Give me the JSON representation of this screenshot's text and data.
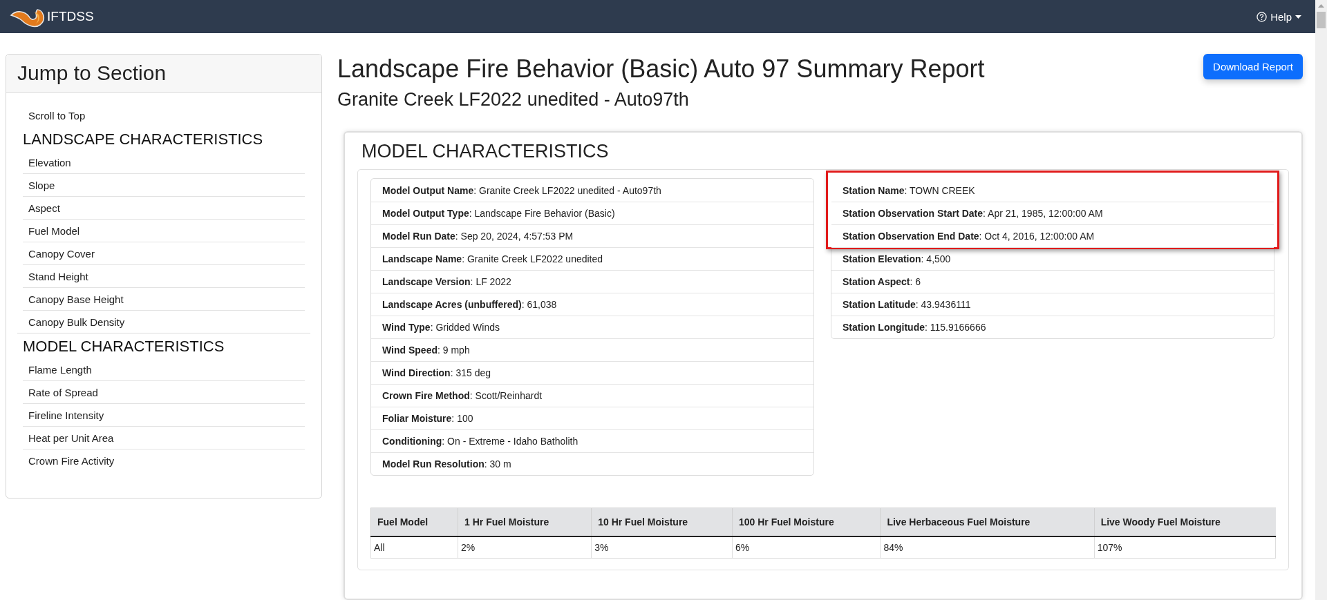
{
  "navbar": {
    "brand": "IFTDSS",
    "help": "Help"
  },
  "sidebar": {
    "title": "Jump to Section",
    "top_link": "Scroll to Top",
    "groups": [
      {
        "heading": "LANDSCAPE CHARACTERISTICS",
        "items": [
          "Elevation",
          "Slope",
          "Aspect",
          "Fuel Model",
          "Canopy Cover",
          "Stand Height",
          "Canopy Base Height",
          "Canopy Bulk Density"
        ]
      },
      {
        "heading": "MODEL CHARACTERISTICS",
        "items": [
          "Flame Length",
          "Rate of Spread",
          "Fireline Intensity",
          "Heat per Unit Area",
          "Crown Fire Activity"
        ]
      }
    ]
  },
  "report": {
    "title": "Landscape Fire Behavior (Basic) Auto 97 Summary Report",
    "subtitle": "Granite Creek LF2022 unedited - Auto97th",
    "download_button": "Download Report"
  },
  "section": {
    "heading": "MODEL CHARACTERISTICS",
    "model_details": [
      {
        "text": "**Model Output Name**: Granite Creek LF2022 unedited - Auto97th"
      },
      {
        "text": "**Model Output Type**: Landscape Fire Behavior (Basic)"
      },
      {
        "text": "**Model Run Date**: Sep 20, 2024, 4:57:53 PM"
      },
      {
        "text": "**Landscape Name**: Granite Creek LF2022 unedited"
      },
      {
        "text": "**Landscape Version**: LF 2022"
      },
      {
        "text": "**Landscape Acres (unbuffered)**: 61,038"
      },
      {
        "text": "**Wind Type**: Gridded Winds"
      },
      {
        "text": "**Wind Speed**: 9 mph"
      },
      {
        "text": "**Wind Direction**: 315 deg"
      },
      {
        "text": "**Crown Fire Method**: Scott/Reinhardt"
      },
      {
        "text": "**Foliar Moisture**: 100"
      },
      {
        "text": "**Conditioning**: On - Extreme - Idaho Batholith"
      },
      {
        "text": "**Model Run Resolution**: 30 m"
      }
    ],
    "station_details": [
      {
        "text": "**Station Name**: TOWN CREEK",
        "highlighted": true
      },
      {
        "text": "**Station Observation Start Date**: Apr 21, 1985, 12:00:00 AM",
        "highlighted": true
      },
      {
        "text": "**Station Observation End Date**: Oct 4, 2016, 12:00:00 AM",
        "highlighted": true
      },
      {
        "text": "**Station Elevation**: 4,500",
        "highlighted": false
      },
      {
        "text": "**Station Aspect**: 6",
        "highlighted": false
      },
      {
        "text": "**Station Latitude**: 43.9436111",
        "highlighted": false
      },
      {
        "text": "**Station Longitude**: 115.9166666",
        "highlighted": false
      }
    ],
    "moisture_table": {
      "columns": [
        "Fuel Model",
        "1 Hr Fuel Moisture",
        "10 Hr Fuel Moisture",
        "100 Hr Fuel Moisture",
        "Live Herbaceous Fuel Moisture",
        "Live Woody Fuel Moisture"
      ],
      "rows": [
        [
          "All",
          "2%",
          "3%",
          "6%",
          "84%",
          "107%"
        ]
      ]
    }
  }
}
